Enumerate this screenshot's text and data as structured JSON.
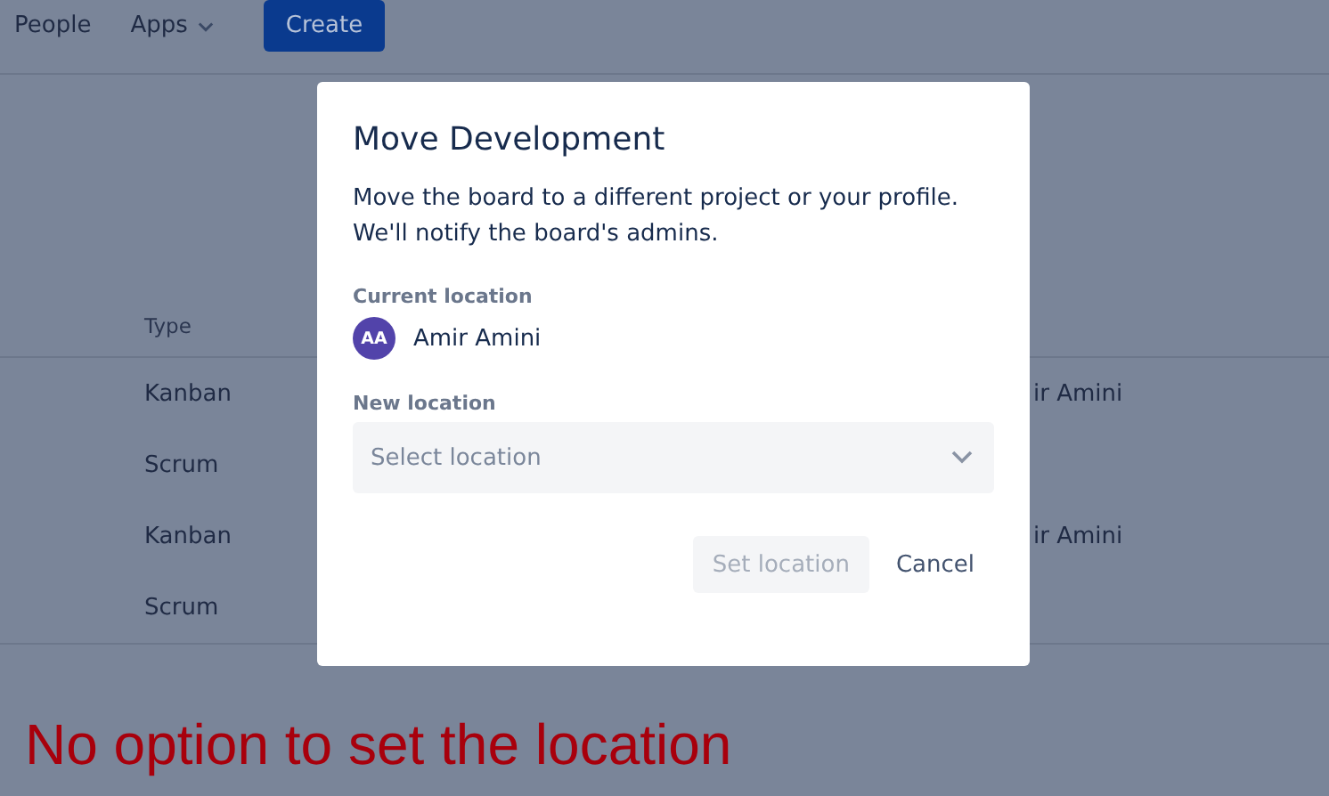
{
  "nav": {
    "items": [
      {
        "label": "People",
        "has_menu": false
      },
      {
        "label": "Apps",
        "has_menu": true
      }
    ],
    "create_button": "Create"
  },
  "table": {
    "columns": [
      "Type"
    ],
    "rows": [
      {
        "type": "Kanban",
        "column_2": "ir Amini"
      },
      {
        "type": "Scrum"
      },
      {
        "type": "Kanban",
        "column_2": "ir Amini"
      },
      {
        "type": "Scrum"
      }
    ]
  },
  "dialog": {
    "title": "Move Development",
    "description": "Move the board to a different project or your profile. We'll notify the board's admins.",
    "current_location": {
      "label": "Current location",
      "avatar_initials": "AA",
      "name": "Amir Amini"
    },
    "new_location": {
      "label": "New location",
      "placeholder": "Select location"
    },
    "buttons": [
      {
        "label": "Set location",
        "kind": "primary",
        "disabled": true
      },
      {
        "label": "Cancel",
        "kind": "subtle",
        "disabled": false
      }
    ]
  },
  "annotation": "No option to set the location"
}
